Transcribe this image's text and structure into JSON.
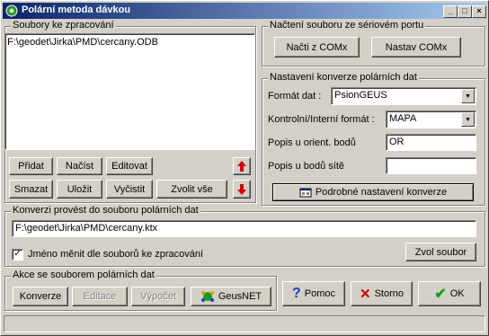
{
  "window": {
    "title": "Polární metoda dávkou"
  },
  "files_group": {
    "title": "Soubory ke zpracování",
    "items": [
      "F:\\geodet\\Jirka\\PMD\\cercany.ODB"
    ],
    "buttons": {
      "add": "Přidat",
      "load": "Načíst",
      "edit": "Editovat",
      "delete": "Smazat",
      "save": "Uložit",
      "clear": "Vyčistit",
      "select_all": "Zvolit vše"
    }
  },
  "serial_group": {
    "title": "Načtení souboru ze sériovém portu",
    "read_button": "Načti z COMx",
    "set_button": "Nastav COMx"
  },
  "conversion_group": {
    "title": "Nastavení konverze polárních dat",
    "format_label": "Formát dat :",
    "format_value": "PsionGEUS",
    "control_label": "Kontrolní/Interní formát :",
    "control_value": "MAPA",
    "orient_label": "Popis u orient. bodů",
    "orient_value": "OR",
    "network_label": "Popis u bodů sítě",
    "network_value": "",
    "detail_button": "Podrobné nastavení konverze"
  },
  "output_group": {
    "title": "Konverzi provést do souboru polárních dat",
    "file_value": "F:\\geodet\\Jirka\\PMD\\cercany.ktx",
    "checkbox_label": "Jméno měnit dle souborů ke zpracování",
    "checkbox_checked": true,
    "choose_button": "Zvol soubor"
  },
  "actions_group": {
    "title": "Akce se souborem polárních dat",
    "convert": "Konverze",
    "editor": "Editace",
    "compute": "Výpočet",
    "geusnet": "GeusNET"
  },
  "footer": {
    "help": "Pomoc",
    "cancel": "Storno",
    "ok": "OK"
  },
  "colors": {
    "title_start": "#0a246a",
    "title_end": "#a6caf0",
    "face": "#d4d0c8",
    "arrow_red": "#d00000",
    "ok_green": "#1a9a1a",
    "cancel_red": "#cc0000",
    "help_blue": "#1a3fb0"
  }
}
